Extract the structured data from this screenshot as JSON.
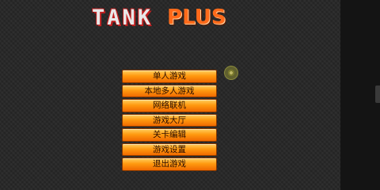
{
  "logo": {
    "word1": "TANK",
    "word2": "PLUS"
  },
  "menu": [
    {
      "label": "单人游戏"
    },
    {
      "label": "本地多人游戏"
    },
    {
      "label": "网络联机"
    },
    {
      "label": "游戏大厅"
    },
    {
      "label": "关卡编辑"
    },
    {
      "label": "游戏设置"
    },
    {
      "label": "退出游戏"
    }
  ],
  "colors": {
    "button_top": "#ffcf60",
    "button_bottom": "#f06a00",
    "plus_orange": "#ff6a1a",
    "tank_red": "#c02020"
  }
}
